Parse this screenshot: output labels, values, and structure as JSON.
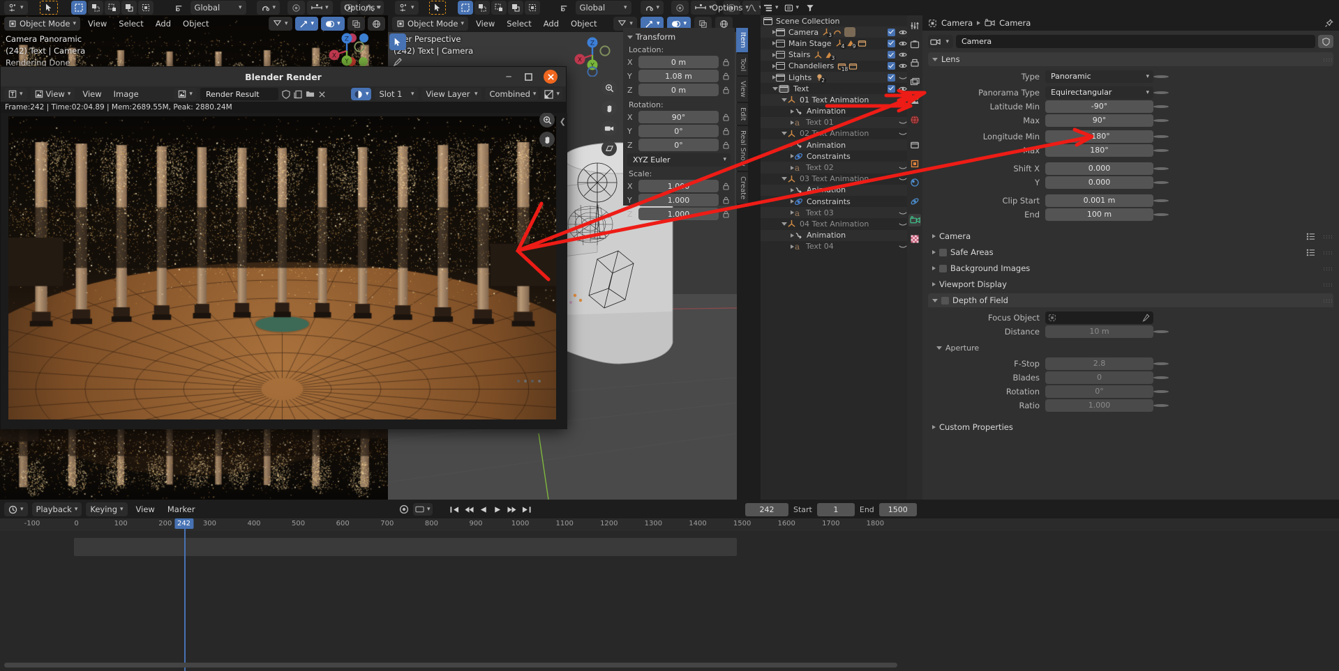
{
  "app": {
    "title": "Blender"
  },
  "topbar": {
    "editor_type": "editor-type-icon",
    "transform_orientation": "Global",
    "snap": "snapping",
    "proportional": "proportional-edit",
    "options": "Options",
    "left_orientation": "Global",
    "right_options": "Options"
  },
  "viewport_left": {
    "mode": "Object Mode",
    "menus": [
      "View",
      "Select",
      "Add",
      "Object"
    ],
    "overlay_text": [
      "Camera Panoramic",
      "(242) Text | Camera",
      "Rendering Done"
    ]
  },
  "viewport_right": {
    "mode": "Object Mode",
    "menus": [
      "View",
      "Select",
      "Add",
      "Object"
    ],
    "overlay_text": [
      "User Perspective",
      "(242) Text | Camera"
    ]
  },
  "render_window": {
    "title": "Blender Render",
    "minimize": "minimize-icon",
    "maximize": "maximize-icon",
    "close": "close-icon",
    "menus": [
      "View",
      "Image"
    ],
    "image_name": "Render Result",
    "slot": "Slot 1",
    "layer": "View Layer",
    "pass": "Combined",
    "stats": "Frame:242 | Time:02:04.89 | Mem:2689.55M, Peak: 2880.24M"
  },
  "transform": {
    "title": "Transform",
    "location_label": "Location:",
    "location": [
      {
        "axis": "X",
        "value": "0 m"
      },
      {
        "axis": "Y",
        "value": "1.08 m"
      },
      {
        "axis": "Z",
        "value": "0 m"
      }
    ],
    "rotation_label": "Rotation:",
    "rotation": [
      {
        "axis": "X",
        "value": "90°"
      },
      {
        "axis": "Y",
        "value": "0°"
      },
      {
        "axis": "Z",
        "value": "0°"
      }
    ],
    "rotation_mode": "XYZ Euler",
    "scale_label": "Scale:",
    "scale": [
      {
        "axis": "X",
        "value": "1.000"
      },
      {
        "axis": "Y",
        "value": "1.000"
      },
      {
        "axis": "Z",
        "value": "1.000"
      }
    ]
  },
  "viewport_tabs": [
    "Item",
    "Tool",
    "View",
    "Edit",
    "Real Snow",
    "Create"
  ],
  "outliner": {
    "root": "Scene Collection",
    "rows": [
      {
        "label": "Scene Collection",
        "indent": 0,
        "type": "collection",
        "expand": "",
        "badges": []
      },
      {
        "label": "Camera",
        "indent": 1,
        "type": "collection",
        "expand": "right",
        "badges": [
          "empty3",
          "curve",
          "camera"
        ]
      },
      {
        "label": "Main Stage",
        "indent": 1,
        "type": "collection",
        "expand": "right",
        "badges": [
          "empty4",
          "mesh9",
          "coll"
        ]
      },
      {
        "label": "Stairs",
        "indent": 1,
        "type": "collection",
        "expand": "right",
        "badges": [
          "empty",
          "mesh3"
        ]
      },
      {
        "label": "Chandeliers",
        "indent": 1,
        "type": "collection",
        "expand": "right",
        "badges": [
          "coll18",
          "coll"
        ]
      },
      {
        "label": "Lights",
        "indent": 1,
        "type": "collection",
        "expand": "right",
        "badges": [
          "light2"
        ]
      },
      {
        "label": "Text",
        "indent": 1,
        "type": "collection",
        "expand": "down",
        "badges": []
      },
      {
        "label": "01 Text Animation",
        "indent": 2,
        "type": "empty",
        "expand": "down",
        "badges": []
      },
      {
        "label": "Animation",
        "indent": 3,
        "type": "anim",
        "expand": "right",
        "badges": [
          "key"
        ]
      },
      {
        "label": "Text 01",
        "indent": 3,
        "type": "font",
        "expand": "right",
        "badges": [
          "curvemod"
        ],
        "dim": true
      },
      {
        "label": "02 Text Animation",
        "indent": 2,
        "type": "empty",
        "expand": "down",
        "badges": [],
        "dim": true
      },
      {
        "label": "Animation",
        "indent": 3,
        "type": "anim",
        "expand": "right",
        "badges": [
          "key"
        ]
      },
      {
        "label": "Constraints",
        "indent": 3,
        "type": "constraint",
        "expand": "right",
        "badges": []
      },
      {
        "label": "Text 02",
        "indent": 3,
        "type": "font",
        "expand": "right",
        "badges": [
          "curvemod"
        ],
        "dim": true
      },
      {
        "label": "03 Text Animation",
        "indent": 2,
        "type": "empty",
        "expand": "down",
        "badges": [],
        "dim": true
      },
      {
        "label": "Animation",
        "indent": 3,
        "type": "anim",
        "expand": "right",
        "badges": [
          "key"
        ]
      },
      {
        "label": "Constraints",
        "indent": 3,
        "type": "constraint",
        "expand": "right",
        "badges": []
      },
      {
        "label": "Text 03",
        "indent": 3,
        "type": "font",
        "expand": "right",
        "badges": [
          "curvemod"
        ],
        "dim": true
      },
      {
        "label": "04 Text Animation",
        "indent": 2,
        "type": "empty",
        "expand": "down",
        "badges": [],
        "dim": true
      },
      {
        "label": "Animation",
        "indent": 3,
        "type": "anim",
        "expand": "right",
        "badges": [
          "key"
        ]
      },
      {
        "label": "Text 04",
        "indent": 3,
        "type": "font",
        "expand": "right",
        "badges": [
          "curvemod"
        ],
        "dim": true
      }
    ]
  },
  "properties": {
    "breadcrumb": [
      "Camera",
      "Camera"
    ],
    "datablock_name": "Camera",
    "sections": {
      "lens": {
        "label": "Lens",
        "rows": [
          {
            "label": "Type",
            "value": "Panoramic",
            "kind": "dropdown"
          },
          {
            "label": "Panorama Type",
            "value": "Equirectangular",
            "kind": "dropdown"
          },
          {
            "label": "Latitude Min",
            "value": "-90°",
            "kind": "num"
          },
          {
            "label": "Max",
            "value": "90°",
            "kind": "num"
          },
          {
            "label": "Longitude Min",
            "value": "-180°",
            "kind": "num"
          },
          {
            "label": "Max",
            "value": "180°",
            "kind": "num"
          },
          {
            "label": "Shift X",
            "value": "0.000",
            "kind": "num"
          },
          {
            "label": "Y",
            "value": "0.000",
            "kind": "num"
          },
          {
            "label": "Clip Start",
            "value": "0.001 m",
            "kind": "num"
          },
          {
            "label": "End",
            "value": "100 m",
            "kind": "num"
          }
        ]
      },
      "collapsed": [
        {
          "label": "Camera",
          "checkbox": false,
          "list": true
        },
        {
          "label": "Safe Areas",
          "checkbox": true,
          "list": true
        },
        {
          "label": "Background Images",
          "checkbox": true,
          "list": false
        },
        {
          "label": "Viewport Display",
          "checkbox": false,
          "list": false
        }
      ],
      "dof": {
        "label": "Depth of Field",
        "rows": [
          {
            "label": "Focus Object",
            "value": "",
            "kind": "object"
          },
          {
            "label": "Distance",
            "value": "10 m",
            "kind": "num"
          }
        ],
        "aperture": {
          "label": "Aperture",
          "rows": [
            {
              "label": "F-Stop",
              "value": "2.8",
              "kind": "num"
            },
            {
              "label": "Blades",
              "value": "0",
              "kind": "num"
            },
            {
              "label": "Rotation",
              "value": "0°",
              "kind": "num"
            },
            {
              "label": "Ratio",
              "value": "1.000",
              "kind": "num"
            }
          ]
        }
      },
      "custom_properties": "Custom Properties"
    }
  },
  "timeline": {
    "menus": [
      "Playback",
      "Keying",
      "View",
      "Marker"
    ],
    "current_frame": "242",
    "start_label": "Start",
    "start": "1",
    "end_label": "End",
    "end": "1500",
    "ticks": [
      "-100",
      "0",
      "100",
      "200",
      "300",
      "400",
      "500",
      "600",
      "700",
      "800",
      "900",
      "1000",
      "1100",
      "1200",
      "1300",
      "1400",
      "1500",
      "1600",
      "1700",
      "1800"
    ],
    "transport": [
      "jump-start-icon",
      "prev-keyframe-icon",
      "play-reverse-icon",
      "play-icon",
      "next-keyframe-icon",
      "jump-end-icon"
    ]
  },
  "colors": {
    "accent": "#4772b3",
    "annotation_red": "#ee1c16",
    "panel_bg": "#303030",
    "editor_bg": "#282828",
    "header_bg": "#1d1d1d",
    "field": "#545454",
    "orange": "#e87d0d"
  }
}
